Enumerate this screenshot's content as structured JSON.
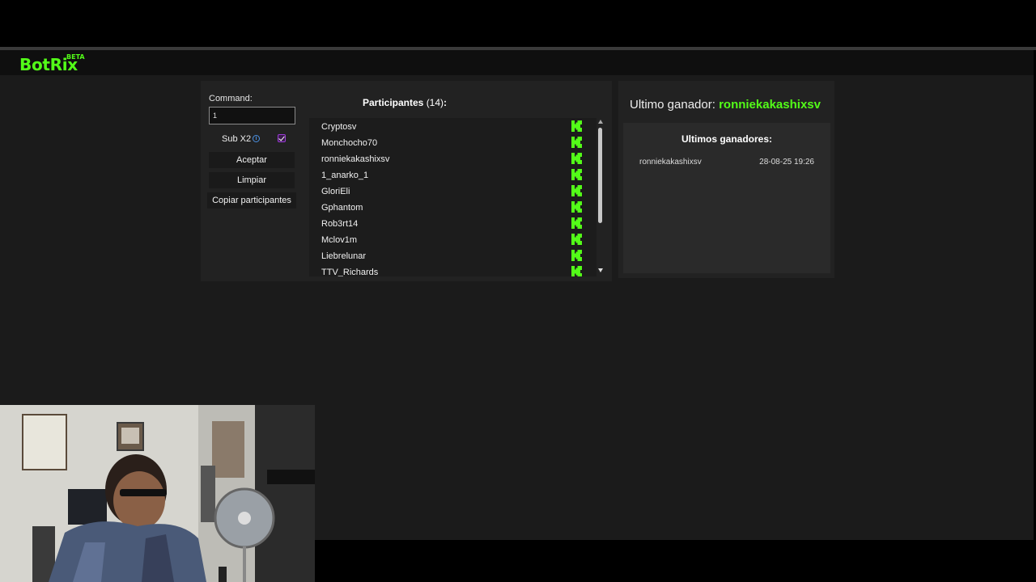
{
  "app": {
    "brand": "BotRix",
    "beta": "BETA"
  },
  "controls": {
    "command_label": "Command:",
    "command_value": "1",
    "sub_label": "Sub X2",
    "sub_checked": true,
    "aceptar": "Aceptar",
    "limpiar": "Limpiar",
    "copiar": "Copiar participantes"
  },
  "participants": {
    "title": "Participantes",
    "count": "(14)",
    "suffix": ":",
    "items": [
      {
        "name": "Cryptosv"
      },
      {
        "name": "Monchocho70"
      },
      {
        "name": "ronniekakashixsv"
      },
      {
        "name": "1_anarko_1"
      },
      {
        "name": "GloriEli"
      },
      {
        "name": "Gphantom"
      },
      {
        "name": "Rob3rt14"
      },
      {
        "name": "Mclov1m"
      },
      {
        "name": "Liebrelunar"
      },
      {
        "name": "TTV_Richards"
      }
    ]
  },
  "winner": {
    "label": "Ultimo ganador:",
    "name": "ronniekakashixsv",
    "list_title": "Ultimos ganadores:",
    "list": [
      {
        "name": "ronniekakashixsv",
        "date": "28-08-25 19:26"
      }
    ]
  },
  "colors": {
    "accent": "#53fc18",
    "panel": "#222222",
    "background": "#1b1b1b"
  }
}
